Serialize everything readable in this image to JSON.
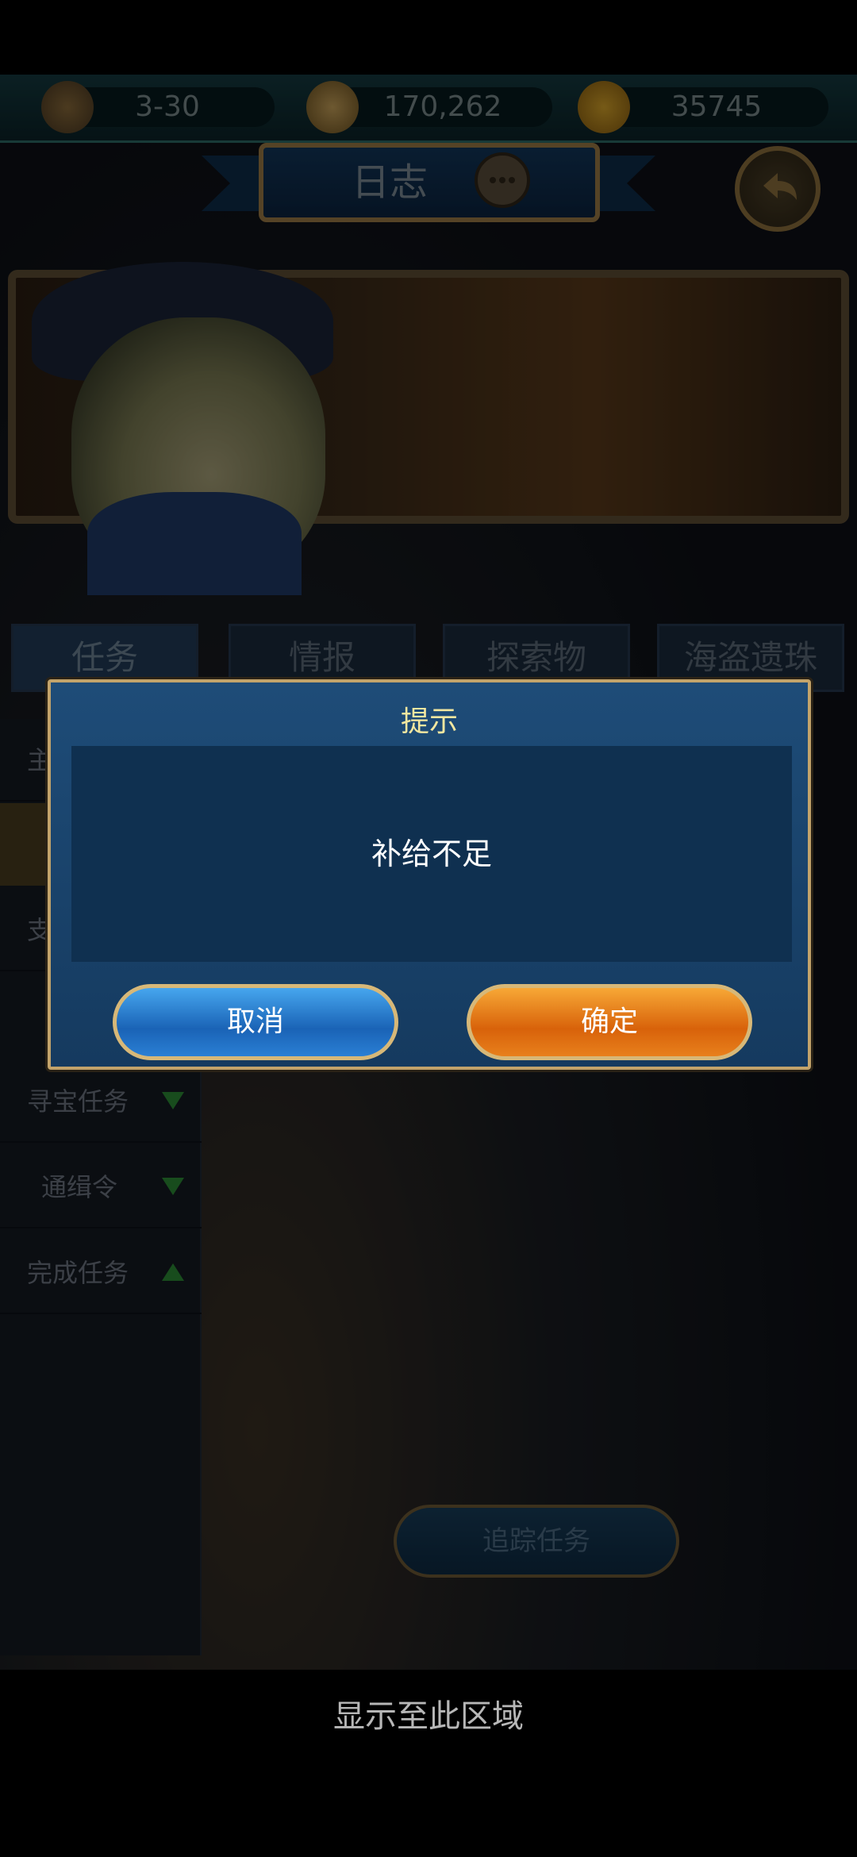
{
  "resources": {
    "hourglass": {
      "icon": "hourglass-icon",
      "value": "3-30"
    },
    "compass": {
      "icon": "compass-icon",
      "value": "170,262"
    },
    "coin": {
      "icon": "anchor-coin-icon",
      "value": "35745"
    }
  },
  "header": {
    "title": "日志"
  },
  "tabs": [
    "任务",
    "情报",
    "探索物",
    "海盗遗珠"
  ],
  "menu": {
    "items": [
      {
        "label": "主",
        "arrow": ""
      },
      {
        "label": "支",
        "arrow": ""
      },
      {
        "label": "寻宝任务",
        "arrow": "down"
      },
      {
        "label": "通缉令",
        "arrow": "down"
      },
      {
        "label": "完成任务",
        "arrow": "up"
      }
    ]
  },
  "track_button": "追踪任务",
  "dialog": {
    "title": "提示",
    "message": "补给不足",
    "cancel": "取消",
    "confirm": "确定"
  },
  "footer_text": "显示至此区域",
  "colors": {
    "dialog_title": "#f3e7a0",
    "cancel": "#1a63b6",
    "confirm": "#d8620a"
  }
}
